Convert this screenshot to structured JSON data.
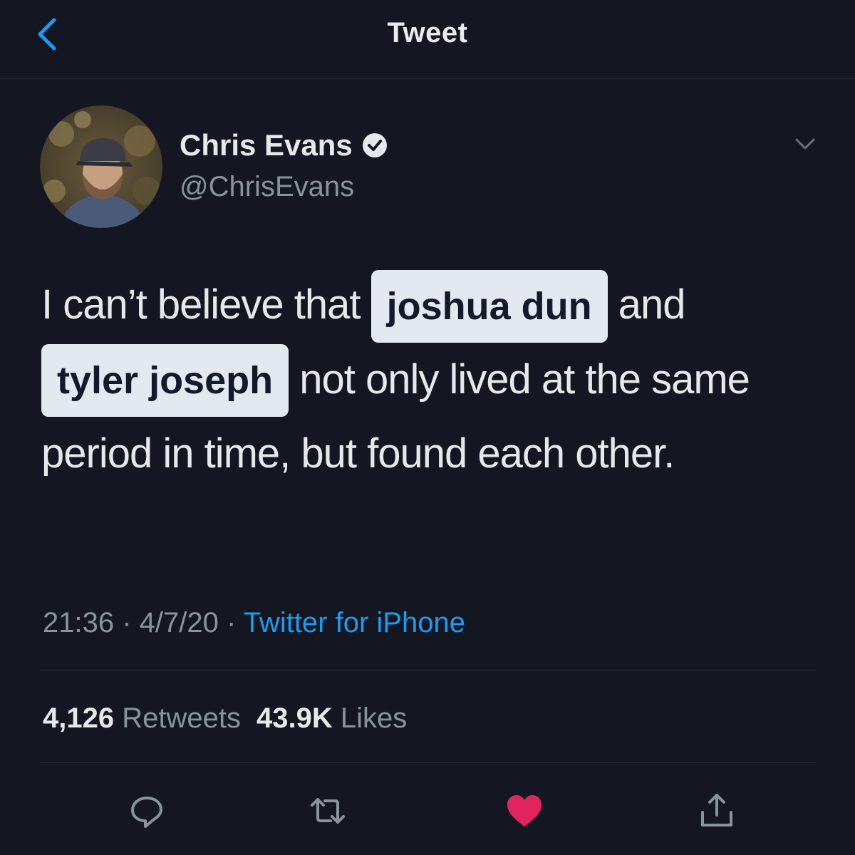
{
  "nav": {
    "title": "Tweet",
    "back_icon": "chevron-left-icon"
  },
  "tweet": {
    "author": {
      "display_name": "Chris Evans",
      "handle": "@ChrisEvans",
      "verified_icon": "verified-badge-icon"
    },
    "text_parts": {
      "p1": "I can’t believe that ",
      "tag1": "joshua dun",
      "p2": " and ",
      "tag2": "tyler joseph",
      "p3": " not only lived at the same period in time, but found each other."
    },
    "meta": {
      "time": "21:36",
      "sep1": " · ",
      "date": "4/7/20",
      "sep2": " · ",
      "source": "Twitter for iPhone"
    },
    "stats": {
      "retweets_count": "4,126",
      "retweets_label": "Retweets",
      "likes_count": "43.9K",
      "likes_label": "Likes"
    },
    "actions": [
      "reply-icon",
      "retweet-icon",
      "like-icon",
      "share-icon"
    ]
  },
  "colors": {
    "background": "#141722",
    "link": "#1d9bf0",
    "like": "#e0245e",
    "tag_bg": "#e4e9f1"
  }
}
